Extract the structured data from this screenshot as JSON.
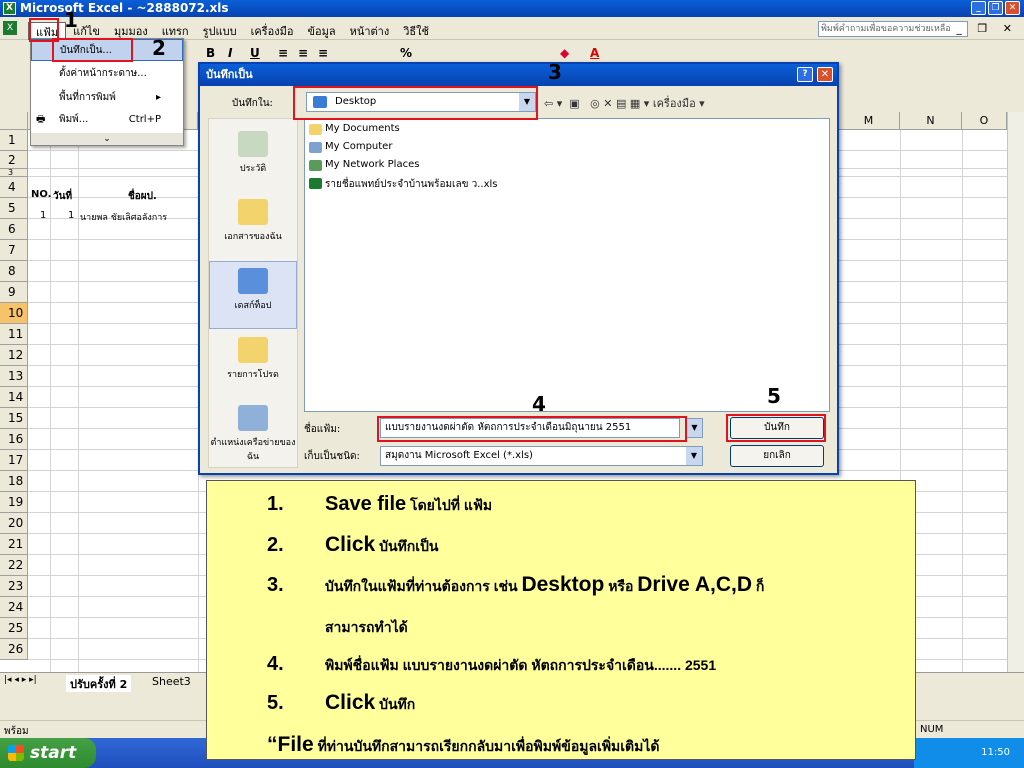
{
  "window": {
    "title": "Microsoft Excel - ~2888072.xls",
    "help_placeholder": "พิมพ์คำถามเพื่อขอความช่วยเหลือ"
  },
  "menubar": {
    "items": [
      "แฟ้ม",
      "แก้ไข",
      "มุมมอง",
      "แทรก",
      "รูปแบบ",
      "เครื่องมือ",
      "ข้อมูล",
      "หน้าต่าง",
      "วิธีใช้"
    ]
  },
  "file_menu": {
    "items": [
      {
        "label": "บันทึกเป็น...",
        "shortcut": ""
      },
      {
        "label": "ตั้งค่าหน้ากระดาษ...",
        "shortcut": ""
      },
      {
        "label": "พื้นที่การพิมพ์",
        "shortcut": "▸"
      },
      {
        "label": "พิมพ์...",
        "shortcut": "Ctrl+P"
      }
    ],
    "more": "¥"
  },
  "toolbar": {
    "bold": "B",
    "italic": "I",
    "underline": "U",
    "percent": "%"
  },
  "grid": {
    "columns_visible": [
      "M",
      "N",
      "O"
    ],
    "rows": [
      "1",
      "2",
      "3",
      "4",
      "5",
      "6",
      "7",
      "8",
      "9",
      "10",
      "11",
      "12",
      "13",
      "14",
      "15",
      "16",
      "17",
      "18",
      "19",
      "20",
      "21",
      "22",
      "23",
      "24",
      "25",
      "26"
    ],
    "selected_row": "10",
    "header_row": {
      "no": "NO.",
      "day": "วันที่",
      "name": "ชื่อผป."
    },
    "row5": {
      "no": "1",
      "day": "1",
      "name": "นายพล ชัยเลิศอลังการ"
    }
  },
  "sheet_tabs": {
    "active": "ปรับครั้งที่ 2",
    "other": "Sheet3"
  },
  "status": {
    "ready": "พร้อม",
    "num": "NUM"
  },
  "taskbar": {
    "start": "start",
    "clock": "11:50"
  },
  "dialog": {
    "title": "บันทึกเป็น",
    "look_in_label": "บันทึกใน:",
    "look_in_value": "Desktop",
    "tools_label": "เครื่องมือ",
    "places": [
      "ประวัติ",
      "เอกสารของฉัน",
      "เดสก์ท็อป",
      "รายการโปรด",
      "ตำแหน่งเครือข่ายของฉัน"
    ],
    "files": [
      "My Documents",
      "My Computer",
      "My Network Places",
      "รายชื่อแพทย์ประจำบ้านพร้อมเลข ว..xls"
    ],
    "filename_label": "ชื่อแฟ้ม:",
    "filename_value": "แบบรายงานงดผ่าตัด หัตถการประจำเดือนมิถุนายน 2551",
    "filetype_label": "เก็บเป็นชนิด:",
    "filetype_value": "สมุดงาน Microsoft Excel (*.xls)",
    "save_button": "บันทึก",
    "cancel_button": "ยกเลิก"
  },
  "callouts": [
    "1",
    "2",
    "3",
    "4",
    "5"
  ],
  "instructions": {
    "s1_num": "1.",
    "s1_a": "Save file",
    "s1_b": " โดยไปที่  แฟ้ม",
    "s2_num": "2.",
    "s2_a": "Click",
    "s2_b": "  บันทึกเป็น",
    "s3_num": "3.",
    "s3_a": "บันทึกในแฟ้มที่ท่านต้องการ เช่น ",
    "s3_b": "Desktop",
    "s3_c": " หรือ ",
    "s3_d": "Drive A,C,D",
    "s3_e": " ก็",
    "s3_line2": "สามารถทำได้",
    "s4_num": "4.",
    "s4_a": "พิมพ์ชื่อแฟ้ม  แบบรายงานงดผ่าตัด หัตถการประจำเดือน....... 2551",
    "s5_num": "5.",
    "s5_a": "Click",
    "s5_b": "  บันทึก",
    "final_a": "“File",
    "final_b": " ที่ท่านบันทึกสามารถเรียกกลับมาเพื่อพิมพ์ข้อมูลเพิ่มเติมได้"
  }
}
